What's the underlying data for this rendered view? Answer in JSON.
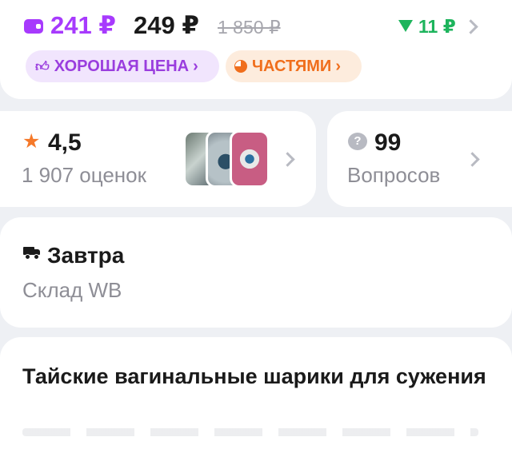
{
  "price": {
    "wallet_price": "241 ₽",
    "regular_price": "249 ₽",
    "old_price": "1 850 ₽",
    "cashback": "11 ₽"
  },
  "chips": {
    "good_price": "ХОРОШАЯ ЦЕНА",
    "installments": "ЧАСТЯМИ",
    "arrow": "›"
  },
  "rating": {
    "value": "4,5",
    "reviews_count": "1 907 оценок"
  },
  "questions": {
    "count": "99",
    "label": "Вопросов",
    "icon_glyph": "?"
  },
  "delivery": {
    "title": "Завтра",
    "warehouse": "Склад WB"
  },
  "product": {
    "title": "Тайские вагинальные шарики для сужения"
  },
  "colors": {
    "wallet_accent": "#a73afd",
    "cashback_green": "#1db45c",
    "installment_orange": "#f06e1c",
    "star_orange": "#f5792a"
  },
  "icons": [
    "wallet-icon",
    "down-triangle-icon",
    "thumb-up-icon",
    "pie-chart-icon",
    "star-icon",
    "question-bubble-icon",
    "truck-icon",
    "chevron-right-icon"
  ]
}
